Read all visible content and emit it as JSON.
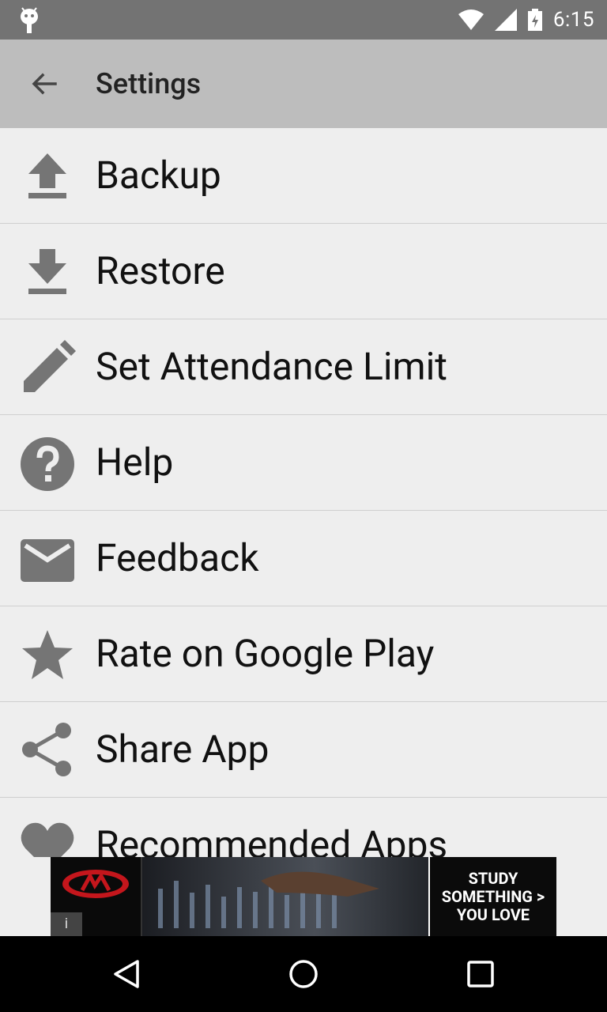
{
  "status_bar": {
    "time": "6:15",
    "icons": [
      "android-icon",
      "wifi-icon",
      "signal-icon",
      "battery-icon"
    ]
  },
  "toolbar": {
    "title": "Settings",
    "back_icon": "arrow-back-icon"
  },
  "settings_items": [
    {
      "label": "Backup",
      "icon": "upload-icon"
    },
    {
      "label": "Restore",
      "icon": "download-icon"
    },
    {
      "label": "Set Attendance Limit",
      "icon": "pencil-icon"
    },
    {
      "label": "Help",
      "icon": "help-icon"
    },
    {
      "label": "Feedback",
      "icon": "mail-icon"
    },
    {
      "label": "Rate on Google Play",
      "icon": "star-icon"
    },
    {
      "label": "Share App",
      "icon": "share-icon"
    },
    {
      "label": "Recommended Apps",
      "icon": "heart-icon"
    }
  ],
  "ad": {
    "cta_line1": "STUDY",
    "cta_line2": "SOMETHING >",
    "cta_line3": "YOU LOVE",
    "info_icon": "i"
  },
  "nav_bar": {
    "buttons": [
      "back-nav-icon",
      "home-nav-icon",
      "recents-nav-icon"
    ]
  },
  "colors": {
    "status_bar": "#737373",
    "toolbar": "#bdbdbd",
    "background": "#eeeeee",
    "icon": "#757575"
  }
}
